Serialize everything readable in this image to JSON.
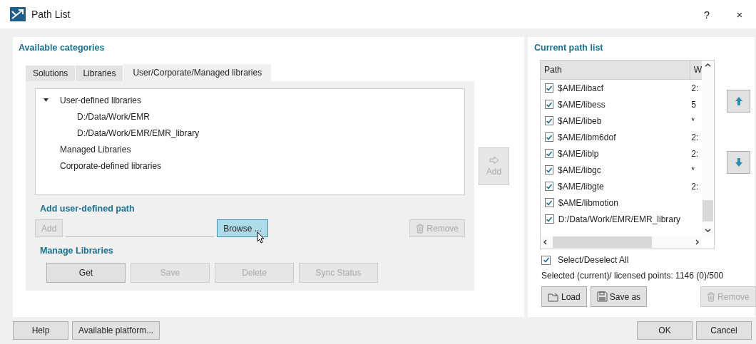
{
  "window": {
    "title": "Path List",
    "help_button": "?",
    "close_button": "×"
  },
  "available": {
    "heading": "Available categories",
    "tabs": [
      {
        "label": "Solutions",
        "selected": false
      },
      {
        "label": "Libraries",
        "selected": false
      },
      {
        "label": "User/Corporate/Managed libraries",
        "selected": true
      }
    ],
    "tree": [
      {
        "label": "User-defined libraries",
        "expanded": true,
        "children": [
          {
            "label": "D:/Data/Work/EMR"
          },
          {
            "label": "D:/Data/Work/EMR/EMR_library"
          }
        ]
      },
      {
        "label": "Managed Libraries"
      },
      {
        "label": "Corporate-defined libraries"
      }
    ],
    "add_path": {
      "heading": "Add user-defined path",
      "add_button": {
        "label": "Add",
        "disabled": true
      },
      "browse_button": {
        "label": "Browse ...",
        "hovered": true
      },
      "remove_button": {
        "label": "Remove",
        "disabled": true
      }
    },
    "manage": {
      "heading": "Manage Libraries",
      "buttons": [
        {
          "label": "Get",
          "disabled": false
        },
        {
          "label": "Save",
          "disabled": true
        },
        {
          "label": "Delete",
          "disabled": true
        },
        {
          "label": "Sync Status",
          "disabled": true
        }
      ]
    }
  },
  "transfer_button": {
    "label": "Add",
    "disabled": true
  },
  "current": {
    "heading": "Current path list",
    "columns": [
      "Path",
      "W"
    ],
    "rows": [
      {
        "path": "$AME/libacf",
        "checked": true,
        "column_2": "2:"
      },
      {
        "path": "$AME/libess",
        "checked": true,
        "column_2": "5"
      },
      {
        "path": "$AME/libeb",
        "checked": true,
        "column_2": "*"
      },
      {
        "path": "$AME/libm6dof",
        "checked": true,
        "column_2": "2:"
      },
      {
        "path": "$AME/liblp",
        "checked": true,
        "column_2": "2:"
      },
      {
        "path": "$AME/libgc",
        "checked": true,
        "column_2": "*"
      },
      {
        "path": "$AME/libgte",
        "checked": true,
        "column_2": "2:"
      },
      {
        "path": "$AME/libmotion",
        "checked": true
      },
      {
        "path": "D:/Data/Work/EMR/EMR_library",
        "checked": true
      }
    ],
    "select_all": {
      "label": "Select/Deselect All",
      "checked": true
    },
    "points": "Selected (current)/ licensed points:  1146 (0)/500",
    "buttons": [
      {
        "kind": "load",
        "label": "Load",
        "disabled": false
      },
      {
        "kind": "save",
        "label": "Save as",
        "disabled": false
      },
      {
        "kind": "remove",
        "label": "Remove",
        "disabled": true
      }
    ]
  },
  "footer": {
    "left_buttons": [
      "Help",
      "Available platform..."
    ],
    "right_buttons": [
      "OK",
      "Cancel"
    ]
  }
}
